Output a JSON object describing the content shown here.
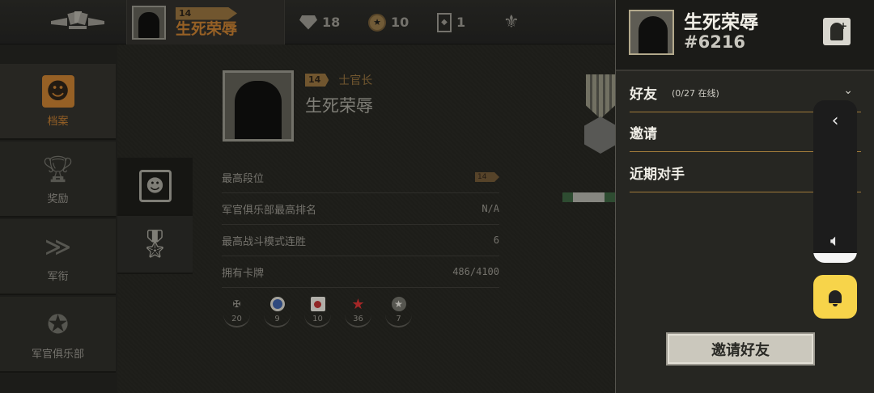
{
  "topbar": {
    "rank_level": "14",
    "player_name": "生死荣辱",
    "cards_count": "18",
    "coins_count": "10",
    "tickets_count": "1"
  },
  "sidebar": {
    "items": [
      {
        "label": "档案",
        "active": true
      },
      {
        "label": "奖励"
      },
      {
        "label": "军衔"
      },
      {
        "label": "军官俱乐部"
      }
    ]
  },
  "profile": {
    "rank_level": "14",
    "rank_title": "士官长",
    "name": "生死荣辱",
    "stats": [
      {
        "label": "最高段位",
        "value": "14"
      },
      {
        "label": "军官俱乐部最高排名",
        "value": "N/A"
      },
      {
        "label": "最高战斗模式连胜",
        "value": "6"
      },
      {
        "label": "拥有卡牌",
        "value": "486/4100"
      }
    ],
    "factions": [
      {
        "icon": "cross-icon",
        "count": "20",
        "color": "#8e8c84"
      },
      {
        "icon": "roundel-icon",
        "count": "9",
        "color": "#3a5a9a"
      },
      {
        "icon": "rising-sun-icon",
        "count": "10",
        "color": "#b03030"
      },
      {
        "icon": "red-star-icon",
        "count": "36",
        "color": "#c83030"
      },
      {
        "icon": "white-star-icon",
        "count": "7",
        "color": "#c8c6be"
      }
    ]
  },
  "friends_panel": {
    "name": "生死荣辱",
    "id": "#6216",
    "rows": {
      "friends_label": "好友",
      "online_count": "(0/27 在线)",
      "invite_label": "邀请",
      "recent_label": "近期对手"
    },
    "invite_button": "邀请好友"
  }
}
